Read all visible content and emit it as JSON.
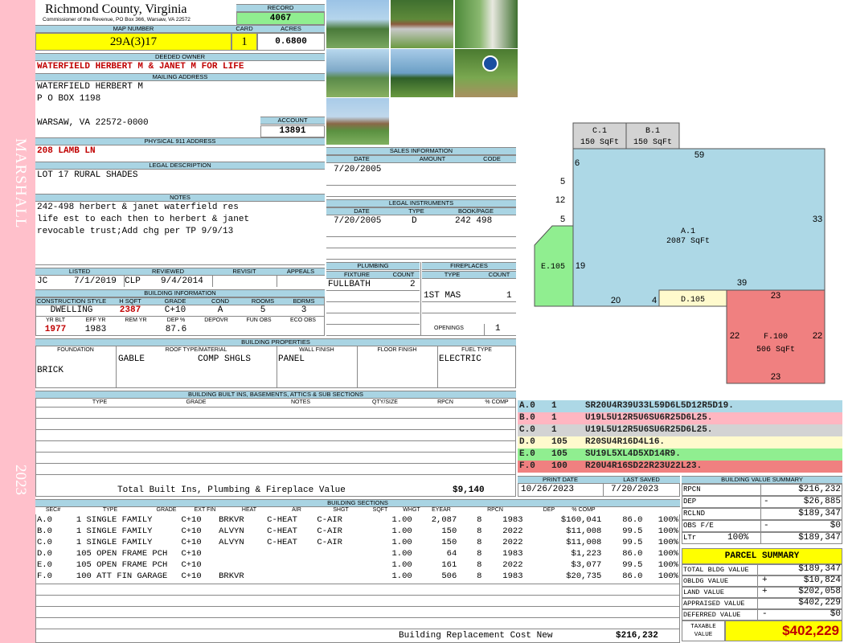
{
  "side_labels": {
    "district": "MARSHALL",
    "year": "2023"
  },
  "header": {
    "county": "Richmond County, Virginia",
    "commissioner": "Commissioner of the Revenue, PO Box 366, Warsaw, VA 22572",
    "record_label": "RECORD",
    "record": "4067",
    "map_label": "MAP NUMBER",
    "map_number": "29A(3)17",
    "card_label": "CARD",
    "card": "1",
    "acres_label": "ACRES",
    "acres": "0.6800"
  },
  "owner": {
    "label": "DEEDED OWNER",
    "name": "WATERFIELD HERBERT M & JANET M FOR LIFE"
  },
  "mailing": {
    "label": "MAILING ADDRESS",
    "line1": "WATERFIELD HERBERT M",
    "line2": "P O BOX 1198",
    "line3": "WARSAW, VA 22572-0000",
    "account_label": "ACCOUNT",
    "account": "13891"
  },
  "physical": {
    "label": "PHYSICAL 911 ADDRESS",
    "address": "208 LAMB LN"
  },
  "legal": {
    "label": "LEGAL DESCRIPTION",
    "text": "LOT 17 RURAL SHADES"
  },
  "notes": {
    "label": "NOTES",
    "line1": "242-498 herbert & janet waterfield res",
    "line2": "life est to each then to herbert & janet",
    "line3": "revocable trust;Add chg per TP 9/9/13"
  },
  "review": {
    "listed_label": "LISTED",
    "reviewed_label": "REVIEWED",
    "revisit_label": "REVISIT",
    "appeals_label": "APPEALS",
    "listed_by": "JC",
    "listed_date": "7/1/2019",
    "reviewed_by": "CLP",
    "reviewed_date": "9/4/2014"
  },
  "building_info": {
    "label": "BUILDING INFORMATION",
    "h": [
      "CONSTRUCTION STYLE",
      "H SQFT",
      "GRADE",
      "COND",
      "ROOMS",
      "BDRMS"
    ],
    "v": [
      "DWELLING",
      "2387",
      "C+10",
      "A",
      "5",
      "3"
    ],
    "h2": [
      "YR BLT",
      "EFF YR",
      "REM YR",
      "DEP %",
      "DEPOVR",
      "FUN OBS",
      "ECO OBS"
    ],
    "v2": [
      "1977",
      "1983",
      "",
      "87.6",
      "",
      "",
      ""
    ]
  },
  "sales": {
    "label": "SALES INFORMATION",
    "h": [
      "DATE",
      "AMOUNT",
      "CODE"
    ],
    "date": "7/20/2005"
  },
  "legal_inst": {
    "label": "LEGAL INSTRUMENTS",
    "h": [
      "DATE",
      "TYPE",
      "BOOK/PAGE"
    ],
    "date": "7/20/2005",
    "type": "D",
    "book": "242 498"
  },
  "plumbing": {
    "label": "PLUMBING",
    "h": [
      "FIXTURE",
      "COUNT"
    ],
    "fixture": "FULLBATH",
    "count": "2"
  },
  "fireplaces": {
    "label": "FIREPLACES",
    "h": [
      "TYPE",
      "COUNT"
    ],
    "type": "1ST MAS",
    "count": "1",
    "openings_label": "OPENINGS",
    "openings": "1"
  },
  "properties": {
    "label": "BUILDING PROPERTIES",
    "h": [
      "FOUNDATION",
      "ROOF TYPE/MATERIAL",
      "WALL FINISH",
      "FLOOR FINISH",
      "FUEL TYPE"
    ],
    "foundation": "BRICK",
    "roof_type": "GABLE",
    "roof_mat": "COMP SHGLS",
    "wall": "PANEL",
    "fuel": "ELECTRIC"
  },
  "builtins": {
    "label": "BUILDING BUILT INS, BASEMENTS, ATTICS & SUB SECTIONS",
    "h": [
      "TYPE",
      "GRADE",
      "NOTES",
      "QTY/SIZE",
      "RPCN",
      "% COMP"
    ],
    "total_label": "Total Built Ins, Plumbing & Fireplace Value",
    "total": "$9,140"
  },
  "sketch": {
    "c1": "C.1",
    "c1s": "150 SqFt",
    "b1": "B.1",
    "b1s": "150 SqFt",
    "a1": "A.1",
    "a1s": "2087 SqFt",
    "e": "E.105",
    "d": "D.105",
    "f": "F.100",
    "fs": "506 SqFt",
    "dims": {
      "t59": "59",
      "t6": "6",
      "t5a": "5",
      "t12": "12",
      "t5b": "5",
      "t19": "19",
      "t20": "20",
      "t4": "4",
      "t39": "39",
      "t33": "33",
      "t23a": "23",
      "t22a": "22",
      "t22b": "22",
      "t23b": "23"
    },
    "colors": {
      "A": "#add8e6",
      "B": "#ffb6c1",
      "C": "#d3d3d3",
      "D": "#fffacd",
      "E": "#90ee90",
      "F": "#f08080"
    }
  },
  "codes": [
    {
      "sec": "A.0",
      "n": "1",
      "code": "SR20U4R39U33L59D6L5D12R5D19.",
      "color": "#add8e6"
    },
    {
      "sec": "B.0",
      "n": "1",
      "code": "U19L5U12R5U6SU6R25D6L25.",
      "color": "#ffb6c1"
    },
    {
      "sec": "C.0",
      "n": "1",
      "code": "U19L5U12R5U6SU6R25D6L25.",
      "color": "#d3d3d3"
    },
    {
      "sec": "D.0",
      "n": "105",
      "code": "R20SU4R16D4L16.",
      "color": "#fffacd"
    },
    {
      "sec": "E.0",
      "n": "105",
      "code": "SU19L5XL4D5XD14R9.",
      "color": "#90ee90"
    },
    {
      "sec": "F.0",
      "n": "100",
      "code": "R20U4R16SD22R23U22L23.",
      "color": "#f08080"
    }
  ],
  "dates": {
    "print_label": "PRINT DATE",
    "print": "10/26/2023",
    "saved_label": "LAST SAVED",
    "saved": "7/20/2023"
  },
  "sections": {
    "label": "BUILDING SECTIONS",
    "h": [
      "SEC#",
      "TYPE",
      "GRADE",
      "EXT FIN",
      "HEAT",
      "AIR",
      "SHGT",
      "SQFT",
      "WHGT",
      "EYEAR",
      "RPCN",
      "DEP",
      "% COMP"
    ],
    "rows": [
      [
        "A.0",
        "1 SINGLE FAMILY",
        "C+10",
        "BRKVR",
        "C-HEAT",
        "C-AIR",
        "1.00",
        "2,087",
        "8",
        "1983",
        "$160,041",
        "86.0",
        "100%"
      ],
      [
        "B.0",
        "1 SINGLE FAMILY",
        "C+10",
        "ALVYN",
        "C-HEAT",
        "C-AIR",
        "1.00",
        "150",
        "8",
        "2022",
        "$11,008",
        "99.5",
        "100%"
      ],
      [
        "C.0",
        "1 SINGLE FAMILY",
        "C+10",
        "ALVYN",
        "C-HEAT",
        "C-AIR",
        "1.00",
        "150",
        "8",
        "2022",
        "$11,008",
        "99.5",
        "100%"
      ],
      [
        "D.0",
        "105 OPEN FRAME PCH",
        "C+10",
        "",
        "",
        "",
        "1.00",
        "64",
        "8",
        "1983",
        "$1,223",
        "86.0",
        "100%"
      ],
      [
        "E.0",
        "105 OPEN FRAME PCH",
        "C+10",
        "",
        "",
        "",
        "1.00",
        "161",
        "8",
        "2022",
        "$3,077",
        "99.5",
        "100%"
      ],
      [
        "F.0",
        "100 ATT FIN GARAGE",
        "C+10",
        "BRKVR",
        "",
        "",
        "1.00",
        "506",
        "8",
        "1983",
        "$20,735",
        "86.0",
        "100%"
      ]
    ],
    "total_label": "Building Replacement Cost New",
    "total": "$216,232"
  },
  "value_summary": {
    "label": "BUILDING VALUE SUMMARY",
    "rpcn_l": "RPCN",
    "rpcn": "$216,232",
    "dep_l": "DEP",
    "dep_s": "-",
    "dep": "$26,885",
    "rclnd_l": "RCLND",
    "rclnd": "$189,347",
    "obs_l": "OBS F/E",
    "obs_s": "-",
    "obs": "$0",
    "ltr_l": "LTr",
    "ltr_p": "100%",
    "ltr": "$189,347"
  },
  "parcel": {
    "label": "PARCEL SUMMARY",
    "rows": [
      [
        "TOTAL BLDG VALUE",
        "",
        "$189,347"
      ],
      [
        "OBLDG VALUE",
        "+",
        "$10,824"
      ],
      [
        "LAND VALUE",
        "+",
        "$202,058"
      ],
      [
        "APPRAISED VALUE",
        "",
        "$402,229"
      ],
      [
        "DEFERRED VALUE",
        "-",
        "$0"
      ]
    ],
    "taxable_l1": "TAXABLE",
    "taxable_l2": "VALUE",
    "taxable": "$402,229"
  }
}
